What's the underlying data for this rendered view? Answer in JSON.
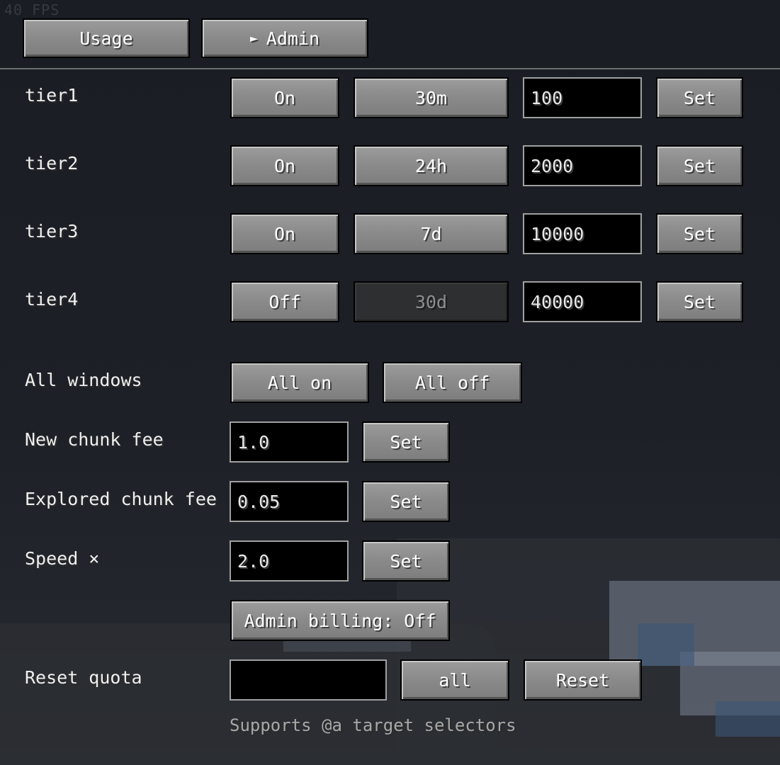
{
  "fps_text": "40 FPS",
  "tabs": [
    {
      "label": "Usage"
    },
    {
      "label": "Admin",
      "arrow": "►"
    }
  ],
  "tiers": [
    {
      "name": "tier1",
      "state": "On",
      "window": "30m",
      "window_enabled": true,
      "amount": "100",
      "set_label": "Set"
    },
    {
      "name": "tier2",
      "state": "On",
      "window": "24h",
      "window_enabled": true,
      "amount": "2000",
      "set_label": "Set"
    },
    {
      "name": "tier3",
      "state": "On",
      "window": "7d",
      "window_enabled": true,
      "amount": "10000",
      "set_label": "Set"
    },
    {
      "name": "tier4",
      "state": "Off",
      "window": "30d",
      "window_enabled": false,
      "amount": "40000",
      "set_label": "Set"
    }
  ],
  "all_windows": {
    "label": "All windows",
    "on_label": "All on",
    "off_label": "All off"
  },
  "new_chunk_fee": {
    "label": "New chunk fee",
    "value": "1.0",
    "set_label": "Set"
  },
  "explored_chunk_fee": {
    "label": "Explored chunk fee",
    "value": "0.05",
    "set_label": "Set"
  },
  "speed": {
    "label": "Speed ×",
    "value": "2.0",
    "set_label": "Set"
  },
  "admin_billing": {
    "label": "Admin billing: Off"
  },
  "reset_quota": {
    "label": "Reset quota",
    "value": "",
    "all_label": "all",
    "reset_label": "Reset"
  },
  "hint": "Supports @a target selectors"
}
